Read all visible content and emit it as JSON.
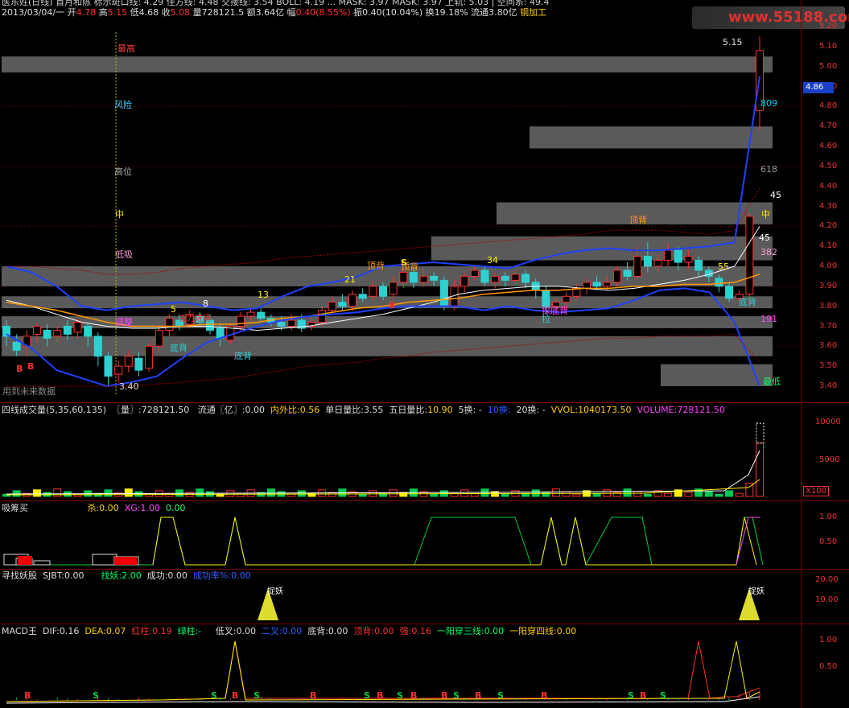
{
  "top_header": {
    "line1": "医东姓(日线) 首月和陈     标示斑口线: 4.29        佳方线: 4.48  交接线: 3.54  BOLL: 4.19  ...  MASK: 3.97  MASK: 3.97  上轨: 5.03  |  空间系: 49.4",
    "date": "2013/03/04/一",
    "open_label": "开",
    "open": "4.78",
    "high_label": "高",
    "high": "5.15",
    "low_label": "低",
    "low": "4.68",
    "close_label": "收",
    "close": "5.08",
    "vol_label": "量",
    "vol": "728121.5",
    "amt_label": "额",
    "amt": "3.64亿",
    "chg_label": "幅",
    "chg": "0.40(8.55%)",
    "amp_label": "振",
    "amp": "0.40(10.04%)",
    "turn_label": "换",
    "turn": "19.18%",
    "float_label": "流通",
    "float": "3.80亿",
    "sector": "钢加工"
  },
  "watermark": "www.55188.com",
  "price_axis": [
    "5.20",
    "5.10",
    "5.00",
    "4.90",
    "4.86",
    "4.80",
    "4.70",
    "4.60",
    "4.50",
    "4.40",
    "4.30",
    "4.20",
    "4.10",
    "4.00",
    "3.90",
    "3.80",
    "3.70",
    "3.60",
    "3.50",
    "3.40"
  ],
  "current_price": "4.86",
  "price_annotations": {
    "zuigao": "最高",
    "fengxian": "风险",
    "gaowei": "高位",
    "zhong_left": "中",
    "zhong_right": "中",
    "dixi": "低吸",
    "zuidi": "最低",
    "wei_shuju": "用到未来数据",
    "n5": "5",
    "n8": "8",
    "n13": "13",
    "n21": "21",
    "n34": "34",
    "n55": "55",
    "n809": "809",
    "n618": "618",
    "n382": "382",
    "n191": "191",
    "n45a": "45",
    "n45b": "45",
    "hi_label": "5.15",
    "lo_label": "3.40",
    "dingbei1": "顶背",
    "dingbei2": "顶背",
    "dingbei3": "顶背",
    "dibei1": "底背",
    "dibei2": "底背",
    "dibei3": "底背",
    "dibei4": "探底背",
    "dibei5": "底背",
    "la": "拉",
    "tiaozheng": "调整",
    "zhuli": "主力进场"
  },
  "vol_header": {
    "title": "四线成交量(5,35,60,135)",
    "liang_label": "〖量〗:",
    "liang": "728121.50",
    "liutong_label": "流通〖亿〗:",
    "liutong": "0.00",
    "neiwai_label": "内外比:",
    "neiwai": "0.56",
    "danri_label": "单日量比:",
    "danri": "3.55",
    "wuri_label": "五日量比:",
    "wuri": "10.90",
    "huan5": "5换: -",
    "huan10": "10换:",
    "huan20": "20换: -",
    "vvol_label": "VVOL:",
    "vvol": "1040173.50",
    "volume_label": "VOLUME:",
    "volume": "728121.50"
  },
  "vol_axis": [
    "10000",
    "5000",
    "X100"
  ],
  "xi_header": {
    "title": "吸筹买",
    "sha_label": "杀:",
    "sha": "0.00",
    "xg_label": "XG:",
    "xg": "1.00",
    "extra": "0.00"
  },
  "xi_axis": [
    "1.00",
    "0.50"
  ],
  "yao_header": {
    "title": "寻找妖股",
    "sjbt_label": "SJBT:",
    "sjbt": "0.00",
    "zhaoyao_label": "找妖:",
    "zhaoyao": "2.00",
    "chenggong_label": "成功:",
    "chenggong": "0.00",
    "lv_label": "成功率%:",
    "lv": "0.00",
    "mark1": "捉妖",
    "mark2": "捉妖"
  },
  "yao_axis": [
    "20.00",
    "10.00"
  ],
  "macd_header": {
    "title": "MACD王",
    "dif_label": "DIF:",
    "dif": "0.16",
    "dea_label": "DEA:",
    "dea": "0.07",
    "hong_label": "红柱:",
    "hong": "0.19",
    "lv_label": "绿柱:",
    "lv": "-",
    "dicha_label": "低叉:",
    "dicha": "0.00",
    "erch_label": "二叉:",
    "erch": "0.00",
    "dibei_label": "底背:",
    "dibei": "0.00",
    "dingbei_label": "顶背:",
    "dingbei": "0.00",
    "qiang_label": "强:",
    "qiang": "0.16",
    "y3_label": "一阳穿三线:",
    "y3": "0.00",
    "y4_label": "一阳穿四线:",
    "y4": "0.00"
  },
  "macd_axis": [
    "1.00",
    "0.50"
  ],
  "colors": {
    "up": "#ff3030",
    "down": "#30d0d0",
    "ma_white": "#ffffff",
    "ma_orange": "#ff9900",
    "band": "#1f3fff",
    "zone": "#5a5a5a"
  }
}
